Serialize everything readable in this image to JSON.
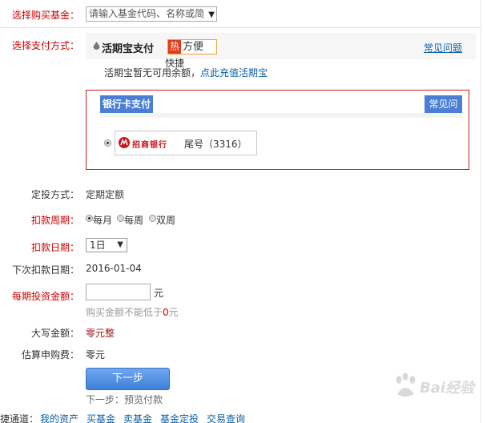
{
  "fund": {
    "label": "选择购买基金：",
    "placeholder": "请输入基金代码、名称或简"
  },
  "payment": {
    "label": "选择支付方式：",
    "huoqibao": {
      "title": "活期宝支付",
      "badge_tag": "热",
      "badge_text": "方便",
      "badge_sub": "快捷",
      "faq": "常见问题",
      "balance_text": "活期宝暂无可用余额，",
      "recharge_link": "点此充值活期宝"
    },
    "bankcard": {
      "title": "银行卡支付",
      "faq": "常见问题",
      "bank_logo_text": "招商银行",
      "tail_label": "尾号（3316）"
    }
  },
  "plan": {
    "mode_label": "定投方式：",
    "mode_value": "定期定额",
    "cycle_label": "扣款周期：",
    "cycle_options": [
      "每月",
      "每周",
      "双周"
    ],
    "day_label": "扣款日期：",
    "day_value": "1日",
    "next_date_label": "下次扣款日期：",
    "next_date_value": "2016-01-04",
    "amount_label": "每期投资金额：",
    "amount_unit": "元",
    "amount_hint_prefix": "购买金额不能低于",
    "amount_hint_value": "0",
    "amount_hint_suffix": "元",
    "capital_label": "大写金额：",
    "capital_value": "零元整",
    "fee_label": "估算申购费：",
    "fee_value": "零元"
  },
  "actions": {
    "next_button": "下一步",
    "next_hint": "下一步：预览付款"
  },
  "bottom_nav": {
    "prefix": "快捷通道：",
    "links": [
      "我的资产",
      "买基金",
      "卖基金",
      "基金定投",
      "交易查询"
    ]
  },
  "watermark": {
    "text": "Bai经验"
  },
  "colors": {
    "required_label": "#cc0000",
    "link": "#0b5ea8",
    "card_border": "#d0191c",
    "header_blue": "#4a7fd4"
  }
}
